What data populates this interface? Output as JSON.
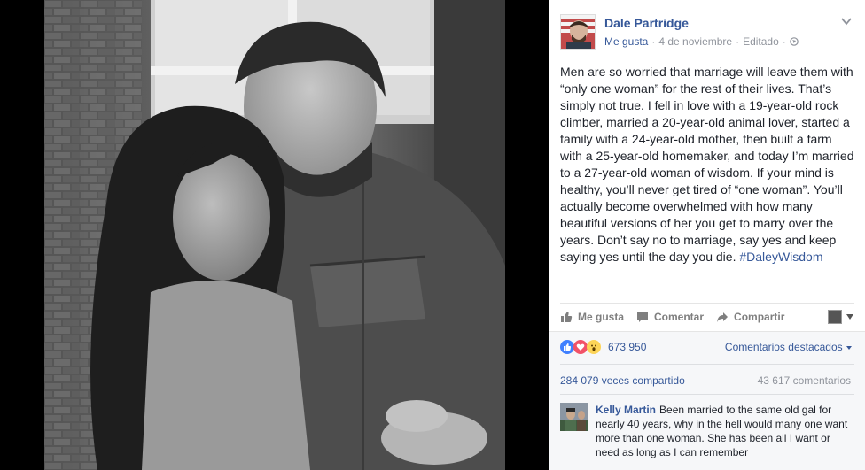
{
  "post": {
    "author": "Dale Partridge",
    "meta": {
      "like_link": "Me gusta",
      "separator": "·",
      "date": "4 de noviembre",
      "edited": "Editado"
    },
    "text": "Men are so worried that marriage will leave them with “only one woman” for the rest of their lives. That’s simply not true. I fell in love with a 19-year-old rock climber, married a 20-year-old animal lover, started a family with a 24-year-old mother, then built a farm with a 25-year-old homemaker, and today I’m married to a 27-year-old woman of wisdom. If your mind is healthy, you’ll never get tired of “one woman”. You’ll actually become overwhelmed with how many beautiful versions of her you get to marry over the years. Don’t say no to marriage, say yes and keep saying yes until the day you die.",
    "hashtag": "#DaleyWisdom"
  },
  "actions": {
    "like": "Me gusta",
    "comment": "Comentar",
    "share": "Compartir"
  },
  "stats": {
    "reactions_count": "673 950",
    "featured_comments": "Comentarios destacados",
    "shares": "284 079 veces compartido",
    "comments": "43 617 comentarios"
  },
  "comment": {
    "name": "Kelly Martin",
    "text": "Been married to the same old gal for nearly 40 years, why in the hell would many one want more than one woman. She has been all I want or need as long as I can remember"
  },
  "colors": {
    "link": "#365899",
    "like_reaction": "#4080ff",
    "love_reaction": "#f25268",
    "wow_reaction": "#fcd458"
  }
}
